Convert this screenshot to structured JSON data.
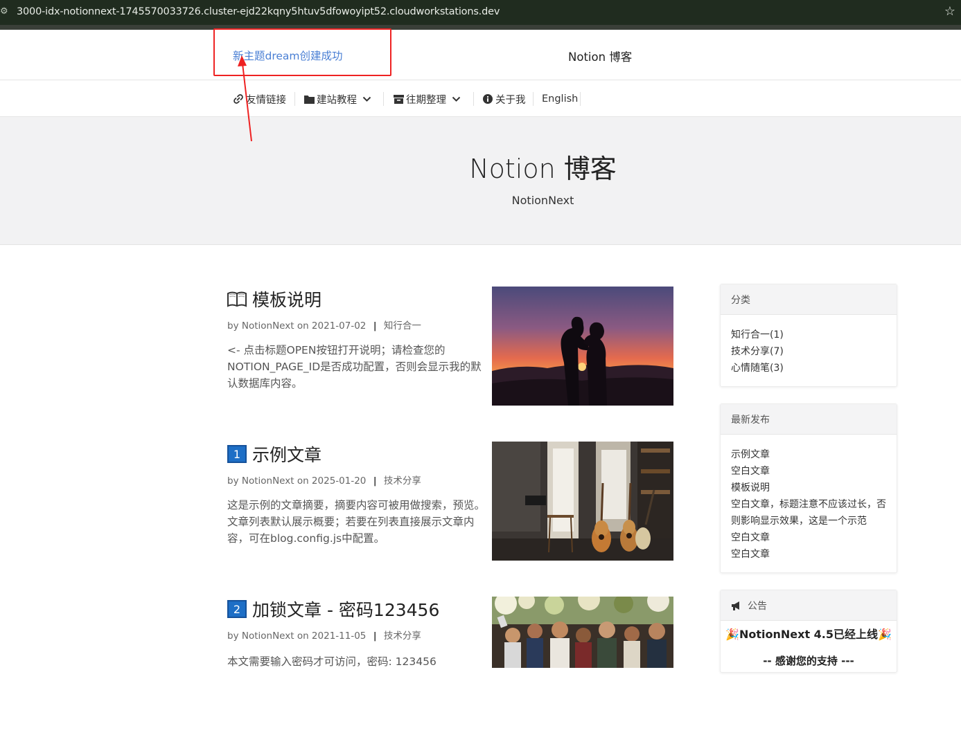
{
  "browser": {
    "url": "3000-idx-notionnext-1745570033726.cluster-ejd22kqny5htuv5dfowoyipt52.cloudworkstations.dev"
  },
  "header": {
    "notice": "新主题dream创建成功",
    "site_title": "Notion 博客"
  },
  "nav": {
    "items": [
      {
        "label": "友情链接",
        "icon": "link-icon"
      },
      {
        "label": "建站教程",
        "icon": "folder-icon"
      },
      {
        "label": "往期整理",
        "icon": "archive-icon"
      },
      {
        "label": "关于我",
        "icon": "info-icon"
      },
      {
        "label": "English"
      }
    ]
  },
  "hero": {
    "title": "Notion 博客",
    "subtitle": "NotionNext"
  },
  "posts": [
    {
      "title": "模板说明",
      "author": "by NotionNext",
      "date": "on 2021-07-02",
      "category": "知行合一",
      "excerpt": "<- 点击标题OPEN按钮打开说明；请检查您的NOTION_PAGE_ID是否成功配置，否则会显示我的默认数据库内容。",
      "icon": "book-icon"
    },
    {
      "title": "示例文章",
      "number": "1",
      "author": "by NotionNext",
      "date": "on 2025-01-20",
      "category": "技术分享",
      "excerpt": "这是示例的文章摘要，摘要内容可被用做搜索，预览。文章列表默认展示概要；若要在列表直接展示文章内容，可在blog.config.js中配置。"
    },
    {
      "title": "加锁文章 - 密码123456",
      "number": "2",
      "author": "by NotionNext",
      "date": "on 2021-11-05",
      "category": "技术分享",
      "excerpt": "本文需要输入密码才可访问，密码: 123456"
    }
  ],
  "sidebar": {
    "categories": {
      "title": "分类",
      "items": [
        "知行合一(1)",
        "技术分享(7)",
        "心情随笔(3)"
      ]
    },
    "latest": {
      "title": "最新发布",
      "items": [
        "示例文章",
        "空白文章",
        "模板说明",
        "空白文章，标题注意不应该过长，否则影响显示效果，这是一个示范",
        "空白文章",
        "空白文章"
      ]
    },
    "announcement": {
      "title": "公告",
      "line1": "NotionNext 4.5已经上线",
      "line2": "-- 感谢您的支持 ---"
    }
  }
}
